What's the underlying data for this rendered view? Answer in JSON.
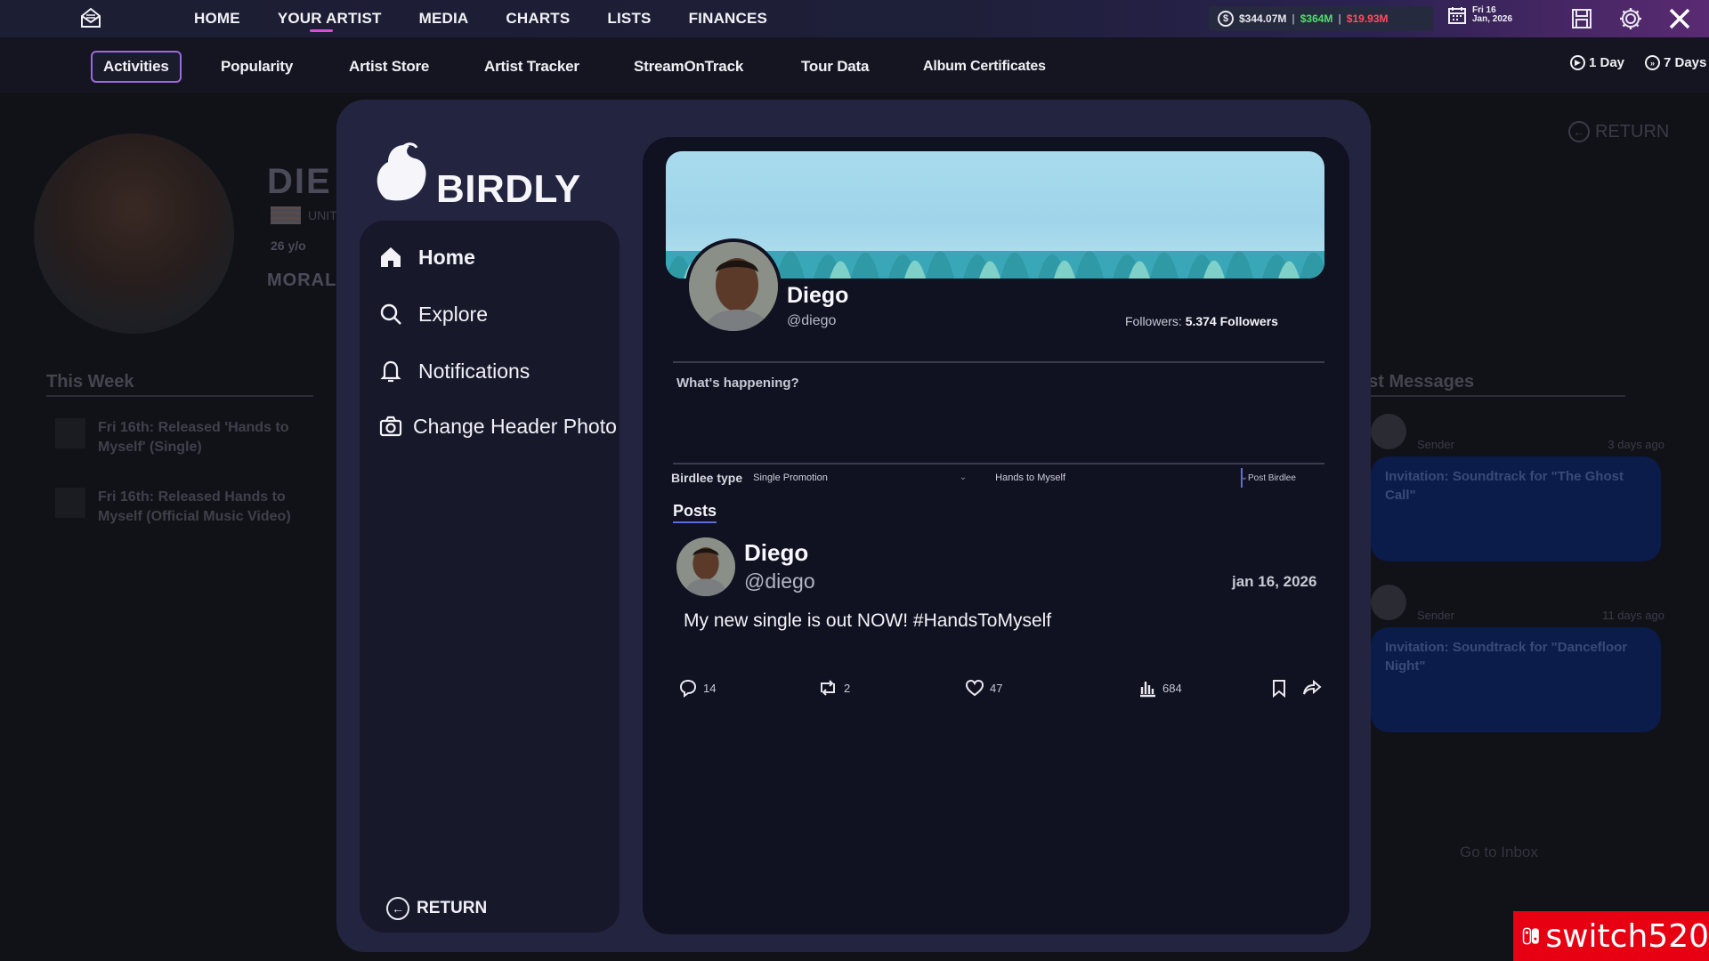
{
  "topnav": {
    "items": [
      {
        "label": "HOME"
      },
      {
        "label": "YOUR ARTIST"
      },
      {
        "label": "MEDIA"
      },
      {
        "label": "CHARTS"
      },
      {
        "label": "LISTS"
      },
      {
        "label": "FINANCES"
      }
    ],
    "active_index": 1
  },
  "money": {
    "balance": "$344.07M",
    "income": "$364M",
    "expense": "$19.93M",
    "income_color": "#4ee06a",
    "expense_color": "#ff4d5e"
  },
  "date": {
    "line1": "Fri 16",
    "line2": "Jan, 2026"
  },
  "subtabs": [
    {
      "label": "Activities"
    },
    {
      "label": "Popularity"
    },
    {
      "label": "Artist Store"
    },
    {
      "label": "Artist Tracker"
    },
    {
      "label": "StreamOnTrack"
    },
    {
      "label": "Tour Data"
    },
    {
      "label": "Album Certificates"
    }
  ],
  "time_buttons": {
    "one_day": "1 Day",
    "seven_days": "7 Days"
  },
  "background": {
    "artist_name": "DIE",
    "country": "UNIT",
    "age": "26 y/o",
    "moral": "MORAL",
    "this_week_title": "This Week",
    "events": [
      {
        "text": "Fri 16th: Released 'Hands to Myself' (Single)"
      },
      {
        "text": "Fri 16th: Released Hands to Myself (Official Music Video)"
      }
    ],
    "return_label": "RETURN",
    "messages_title": "ast Messages",
    "messages": [
      {
        "sender": "Sender",
        "age": "3 days ago",
        "text": "Invitation: Soundtrack for \"The Ghost Call\""
      },
      {
        "sender": "Sender",
        "age": "11 days ago",
        "text": "Invitation: Soundtrack for \"Dancefloor Night\""
      }
    ],
    "inbox_label": "Go to Inbox"
  },
  "birdly": {
    "app_name": "BIRDLY",
    "nav": {
      "home": "Home",
      "explore": "Explore",
      "notifications": "Notifications",
      "change_header": "Change Header Photo",
      "return": "RETURN"
    },
    "profile": {
      "name": "Diego",
      "handle": "@diego",
      "followers_label": "Followers:",
      "followers_value": "5.374 Followers"
    },
    "compose_placeholder": "What's happening?",
    "birdlee_type_label": "Birdlee type",
    "birdlee_type_value": "Single Promotion",
    "birdlee_item_value": "Hands to Myself",
    "post_button": "Post Birdlee",
    "posts_title": "Posts",
    "posts": [
      {
        "name": "Diego",
        "handle": "@diego",
        "date": "jan 16, 2026",
        "text": "My new single is out NOW! #HandsToMyself",
        "replies": "14",
        "reposts": "2",
        "likes": "47",
        "views": "684"
      }
    ]
  },
  "watermark": {
    "text": "switch520",
    "color": "#e60012"
  }
}
